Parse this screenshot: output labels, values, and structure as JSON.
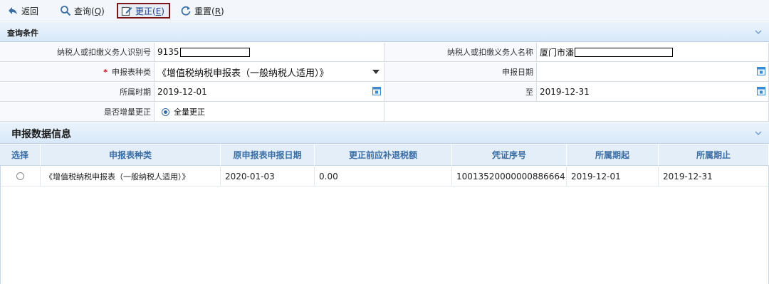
{
  "toolbar": {
    "back_label": "返回",
    "query_label": "查询(",
    "query_key": "Q",
    "correct_label": "更正(",
    "correct_key": "E",
    "reset_label": "重置(",
    "reset_key": "R",
    "close_paren": ")"
  },
  "query_section": {
    "title": "查询条件",
    "taxpayer_id_label": "纳税人或扣缴义务人识别号",
    "taxpayer_id_value": "913",
    "taxpayer_id_value_tail": "5",
    "taxpayer_name_label": "纳税人或扣缴义务人名称",
    "taxpayer_name_value": "厦门市",
    "taxpayer_name_value_tail": "潘",
    "form_type_label": "申报表种类",
    "form_type_required": "*",
    "form_type_value": "《增值税纳税申报表（一般纳税人适用）》",
    "report_date_label": "申报日期",
    "report_date_value": "",
    "period_label": "所属时期",
    "period_from": "2019-12-01",
    "to_label": "至",
    "period_to": "2019-12-31",
    "incremental_label": "是否增量更正",
    "incremental_option": "全量更正"
  },
  "data_section": {
    "title": "申报数据信息",
    "columns": [
      "选择",
      "申报表种类",
      "原申报表申报日期",
      "更正前应补退税额",
      "凭证序号",
      "所属期起",
      "所属期止"
    ],
    "rows": [
      {
        "form_type": "《增值税纳税申报表（一般纳税人适用）》",
        "original_date": "2020-01-03",
        "amount": "0.00",
        "voucher_no": "10013520000000886664",
        "period_start": "2019-12-01",
        "period_end": "2019-12-31"
      }
    ]
  },
  "colors": {
    "header_blue": "#3a6ea5",
    "active_border": "#7a1418",
    "section_bg": "#d8e8f8"
  }
}
